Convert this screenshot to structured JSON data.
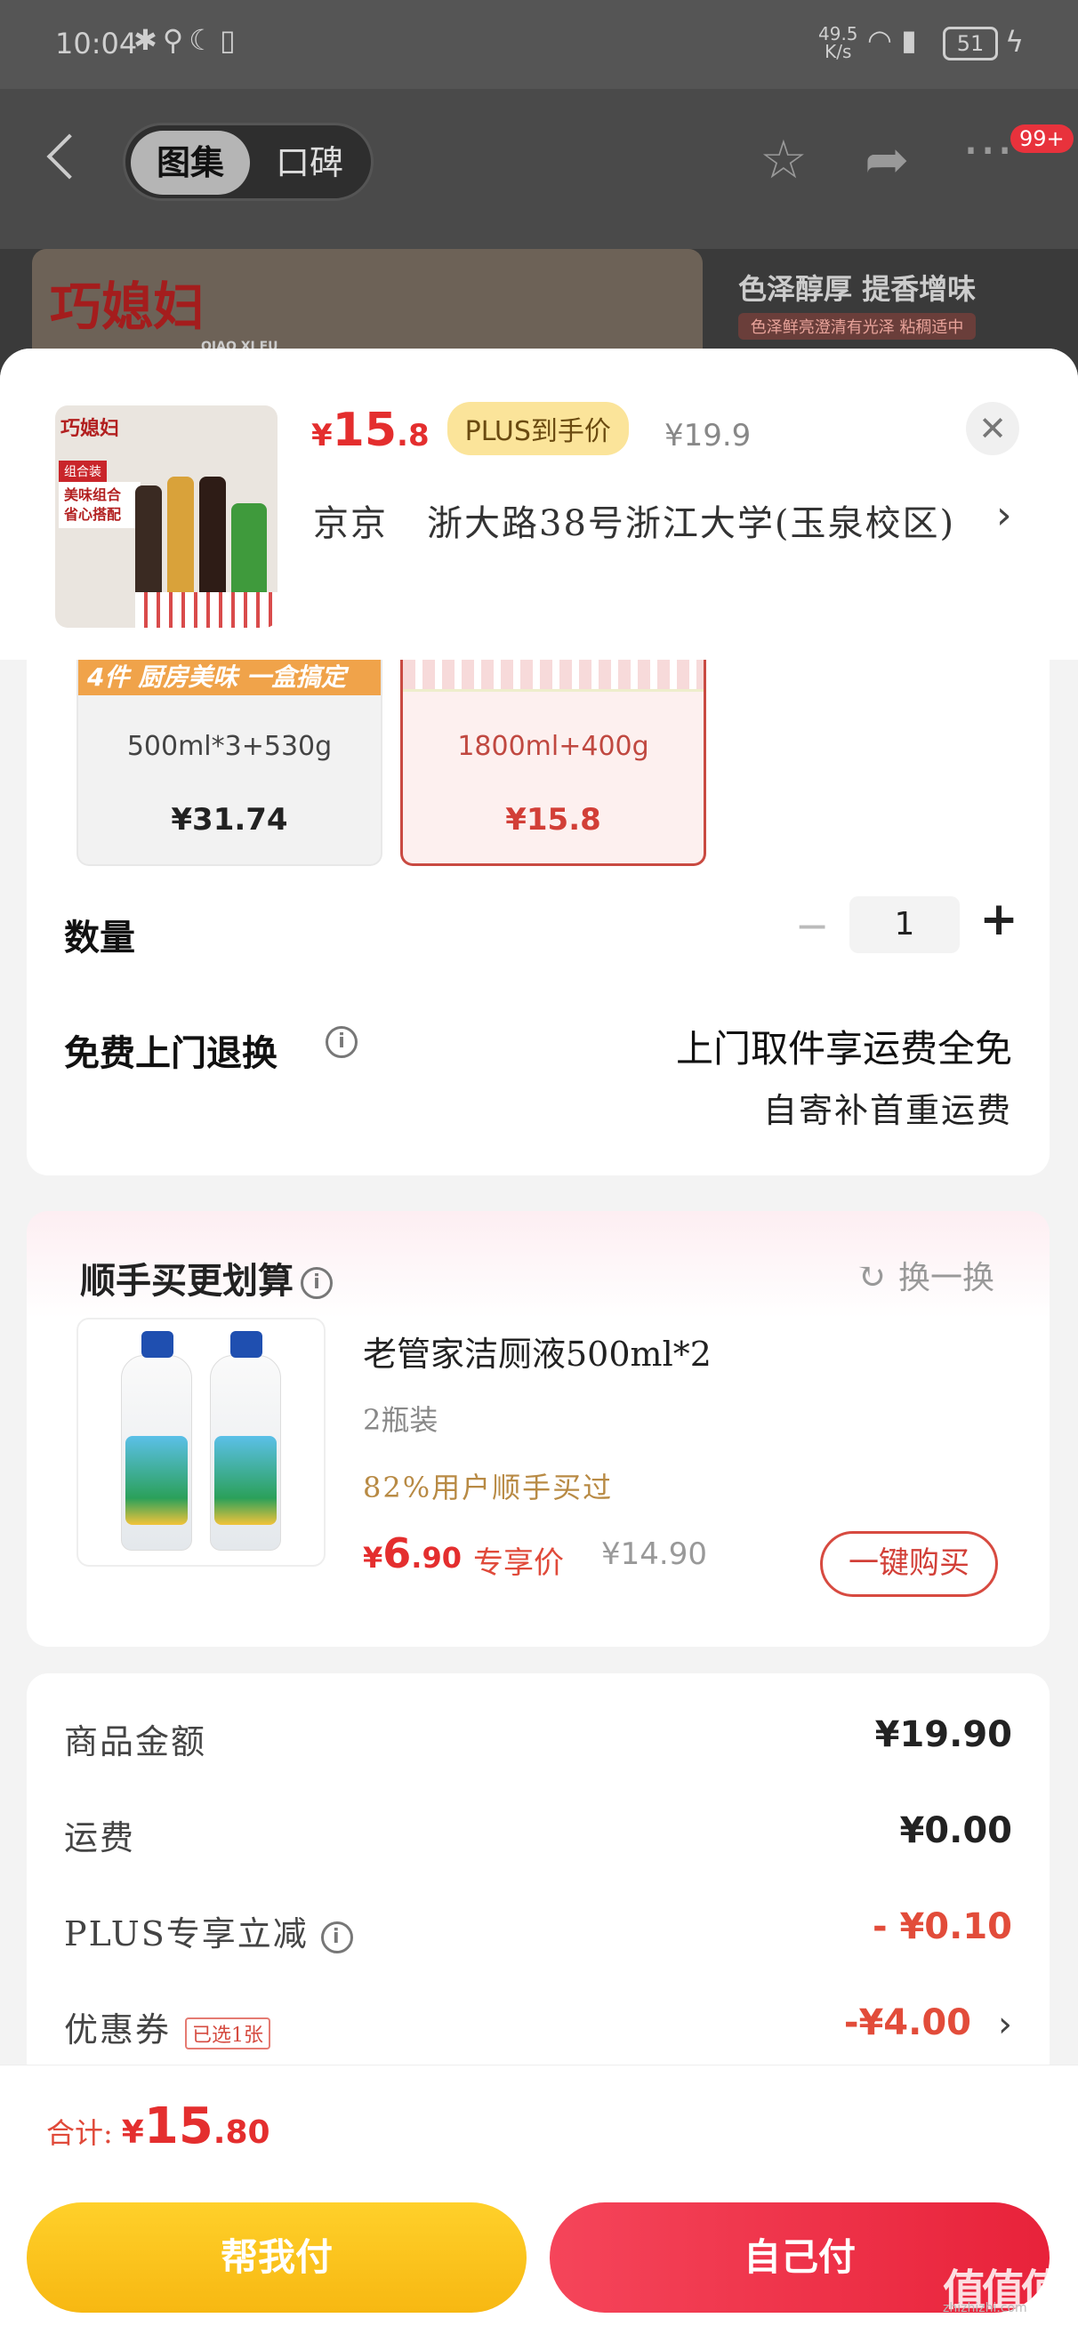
{
  "status_bar": {
    "time": "10:04",
    "net_speed": "49.5",
    "net_unit": "K/s",
    "battery": "51"
  },
  "nav": {
    "tabs": [
      {
        "label": "图集",
        "active": true
      },
      {
        "label": "口碑",
        "active": false
      }
    ],
    "badge": "99+"
  },
  "background": {
    "brand_text": "巧媳妇",
    "brand_sub": "QIAO XI FU",
    "slogan": "色泽醇厚 提香增味",
    "slogan_sub": "色泽鲜亮澄清有光泽 粘稠适中"
  },
  "header": {
    "thumb_brand": "巧媳妇",
    "thumb_tag1": "组合装",
    "thumb_tag2": "美味组合 省心搭配",
    "price": {
      "currency": "¥",
      "int": "15",
      "dec": ".8"
    },
    "plus_tag": "PLUS到手价",
    "original_price": "¥19.9",
    "address_city": "京京",
    "address_detail": "浙大路38号浙江大学(玉泉校区)"
  },
  "variants": [
    {
      "strip": "4件 厨房美味 一盒搞定",
      "spec": "500ml*3+530g",
      "price": "¥31.74",
      "selected": false
    },
    {
      "strip": "",
      "spec": "1800ml+400g",
      "price": "¥15.8",
      "selected": true
    }
  ],
  "quantity": {
    "label": "数量",
    "minus": "−",
    "value": "1",
    "plus": "+"
  },
  "returns": {
    "label": "免费上门退换",
    "line1": "上门取件享运费全免",
    "line2": "自寄补首重运费"
  },
  "upsell": {
    "title": "顺手买更划算",
    "swap": "换一换",
    "product_name": "老管家洁厕液500ml*2",
    "spec": "2瓶装",
    "buy_rate": "82%用户顺手买过",
    "price": {
      "currency": "¥",
      "int": "6",
      "dec": ".90"
    },
    "exclusive": "专享价",
    "original_price": "¥14.90",
    "buy_button": "一键购买"
  },
  "summary": {
    "rows": [
      {
        "label": "商品金额",
        "value": "¥19.90"
      },
      {
        "label": "运费",
        "value": "¥0.00"
      },
      {
        "label": "PLUS专享立减",
        "value": "- ¥0.10"
      },
      {
        "label": "优惠券",
        "value": "-¥4.00",
        "chip": "已选1张"
      }
    ]
  },
  "footer": {
    "total_label": "合计:",
    "total": {
      "currency": "¥",
      "int": "15",
      "dec": ".80"
    },
    "help_pay": "帮我付",
    "self_pay": "自己付"
  },
  "watermark": {
    "text": "值值值",
    "sub": "zhizhizhi.com"
  },
  "colors": {
    "accent_red": "#e42e2e",
    "plus_gold": "#fbe49a",
    "help_pay_yellow": "#f7b812",
    "self_pay_red": "#e8223a"
  }
}
